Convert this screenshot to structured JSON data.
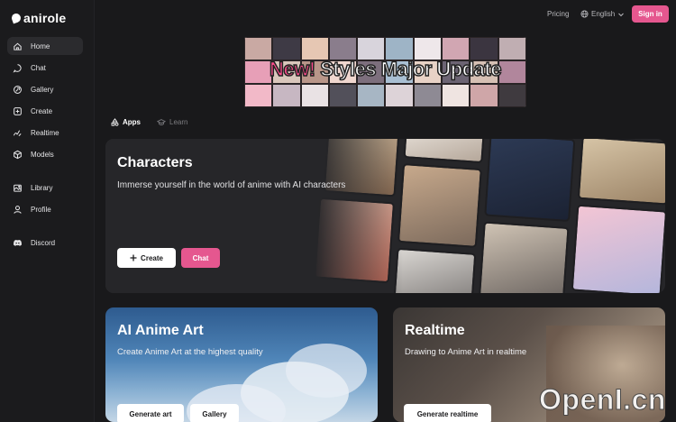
{
  "brand": {
    "name": "anirole"
  },
  "sidebar": {
    "items": [
      {
        "label": "Home",
        "icon": "home-icon"
      },
      {
        "label": "Chat",
        "icon": "chat-icon"
      },
      {
        "label": "Gallery",
        "icon": "gallery-icon"
      },
      {
        "label": "Create",
        "icon": "create-icon"
      },
      {
        "label": "Realtime",
        "icon": "realtime-icon"
      },
      {
        "label": "Models",
        "icon": "models-icon"
      },
      {
        "label": "Library",
        "icon": "library-icon"
      },
      {
        "label": "Profile",
        "icon": "profile-icon"
      },
      {
        "label": "Discord",
        "icon": "discord-icon"
      }
    ]
  },
  "topbar": {
    "pricing": "Pricing",
    "language": "English",
    "signin": "Sign in"
  },
  "banner": {
    "new": "New!",
    "text": "Styles Major Update"
  },
  "tabs": [
    {
      "label": "Apps"
    },
    {
      "label": "Learn"
    }
  ],
  "characters": {
    "title": "Characters",
    "subtitle": "Immerse yourself in the world of anime with AI characters",
    "create_label": "Create",
    "chat_label": "Chat"
  },
  "anime_art": {
    "title": "AI Anime Art",
    "subtitle": "Create Anime Art at the highest quality",
    "generate_label": "Generate art",
    "gallery_label": "Gallery"
  },
  "realtime": {
    "title": "Realtime",
    "subtitle": "Drawing to Anime Art in realtime",
    "generate_label": "Generate realtime"
  },
  "watermark": "OpenI.cn",
  "colors": {
    "accent": "#e5578f",
    "background": "#19191b",
    "sidebar": "#1b1b1d",
    "card": "#262629"
  }
}
